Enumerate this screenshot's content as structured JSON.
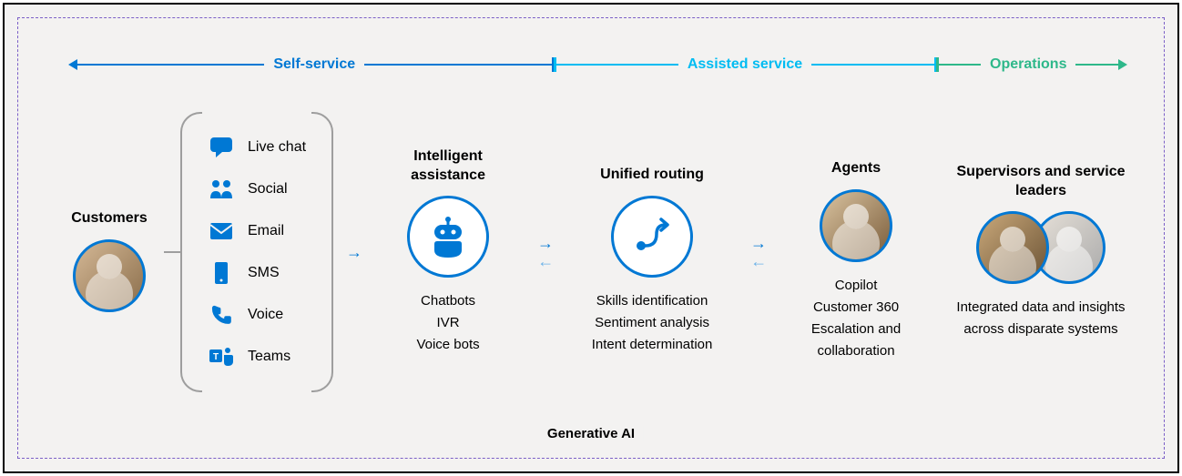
{
  "timeline": {
    "self": "Self-service",
    "assisted": "Assisted service",
    "operations": "Operations"
  },
  "footer_label": "Generative AI",
  "customers": {
    "title": "Customers"
  },
  "channels": [
    {
      "icon": "chat-icon",
      "label": "Live chat"
    },
    {
      "icon": "social-icon",
      "label": "Social"
    },
    {
      "icon": "email-icon",
      "label": "Email"
    },
    {
      "icon": "sms-icon",
      "label": "SMS"
    },
    {
      "icon": "voice-icon",
      "label": "Voice"
    },
    {
      "icon": "teams-icon",
      "label": "Teams"
    }
  ],
  "intelligent": {
    "title": "Intelligent assistance",
    "features": [
      "Chatbots",
      "IVR",
      "Voice bots"
    ]
  },
  "routing": {
    "title": "Unified routing",
    "features": [
      "Skills identification",
      "Sentiment analysis",
      "Intent determination"
    ]
  },
  "agents": {
    "title": "Agents",
    "features": [
      "Copilot",
      "Customer 360",
      "Escalation and collaboration"
    ]
  },
  "supervisors": {
    "title": "Supervisors and service leaders",
    "features": [
      "Integrated data and insights across disparate systems"
    ]
  }
}
